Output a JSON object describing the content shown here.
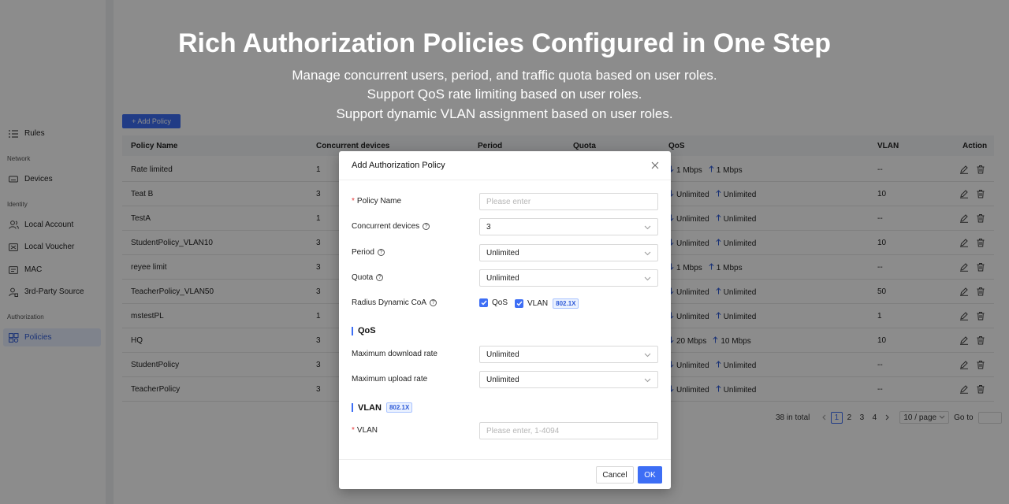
{
  "hero": {
    "title": "Rich Authorization Policies Configured in One Step",
    "lines": [
      "Manage concurrent users, period, and traffic quota based on user roles.",
      "Support QoS rate limiting based on user roles.",
      "Support dynamic VLAN assignment based on user roles."
    ]
  },
  "sidebar": {
    "rules": "Rules",
    "group_network": "Network",
    "devices": "Devices",
    "group_identity": "Identity",
    "local_account": "Local Account",
    "local_voucher": "Local Voucher",
    "mac": "MAC",
    "third_party": "3rd-Party Source",
    "group_authorization": "Authorization",
    "policies": "Policies"
  },
  "toolbar": {
    "add_label": "+ Add Policy"
  },
  "table": {
    "headers": [
      "Policy Name",
      "Concurrent devices",
      "Period",
      "Quota",
      "QoS",
      "VLAN",
      "Action"
    ],
    "rows": [
      {
        "name": "Rate limited",
        "devices": "1",
        "down": "1 Mbps",
        "up": "1 Mbps",
        "vlan": "--"
      },
      {
        "name": "Teat B",
        "devices": "3",
        "down": "Unlimited",
        "up": "Unlimited",
        "vlan": "10"
      },
      {
        "name": "TestA",
        "devices": "1",
        "down": "Unlimited",
        "up": "Unlimited",
        "vlan": "--"
      },
      {
        "name": "StudentPolicy_VLAN10",
        "devices": "3",
        "down": "Unlimited",
        "up": "Unlimited",
        "vlan": "10"
      },
      {
        "name": "reyee limit",
        "devices": "3",
        "down": "1 Mbps",
        "up": "1 Mbps",
        "vlan": "--"
      },
      {
        "name": "TeacherPolicy_VLAN50",
        "devices": "3",
        "down": "Unlimited",
        "up": "Unlimited",
        "vlan": "50"
      },
      {
        "name": "mstestPL",
        "devices": "1",
        "down": "Unlimited",
        "up": "Unlimited",
        "vlan": "1"
      },
      {
        "name": "HQ",
        "devices": "3",
        "down": "20 Mbps",
        "up": "10 Mbps",
        "vlan": "10"
      },
      {
        "name": "StudentPolicy",
        "devices": "3",
        "down": "Unlimited",
        "up": "Unlimited",
        "vlan": "--"
      },
      {
        "name": "TeacherPolicy",
        "devices": "3",
        "down": "Unlimited",
        "up": "Unlimited",
        "vlan": "--"
      }
    ]
  },
  "pagination": {
    "total": "38 in total",
    "pages": [
      "1",
      "2",
      "3",
      "4"
    ],
    "current": "1",
    "page_size": "10 / page",
    "goto": "Go to"
  },
  "modal": {
    "title": "Add Authorization Policy",
    "policy_name_label": "Policy Name",
    "policy_name_placeholder": "Please enter",
    "concurrent_label": "Concurrent devices",
    "concurrent_value": "3",
    "period_label": "Period",
    "period_value": "Unlimited",
    "quota_label": "Quota",
    "quota_value": "Unlimited",
    "coa_label": "Radius Dynamic CoA",
    "coa_qos": "QoS",
    "coa_vlan": "VLAN",
    "tag_8021x": "802.1X",
    "qos_section": "QoS",
    "max_down_label": "Maximum download rate",
    "max_down_value": "Unlimited",
    "max_up_label": "Maximum upload rate",
    "max_up_value": "Unlimited",
    "vlan_section": "VLAN",
    "vlan_label": "VLAN",
    "vlan_placeholder": "Please enter, 1-4094",
    "cancel": "Cancel",
    "ok": "OK"
  },
  "colors": {
    "accent": "#3d6ef5",
    "required": "#e63a3a",
    "overlay": "rgba(0,0,0,0.45)"
  }
}
